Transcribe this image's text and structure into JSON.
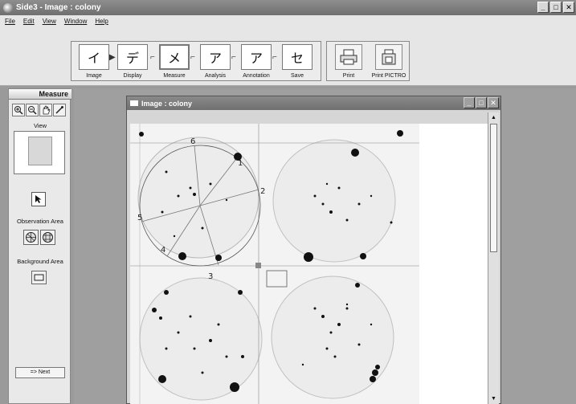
{
  "window": {
    "title": "Side3 - Image : colony"
  },
  "menu": [
    "File",
    "Edit",
    "View",
    "Window",
    "Help"
  ],
  "workflow": [
    {
      "glyph": "イ",
      "label": "Image"
    },
    {
      "glyph": "デ",
      "label": "Display"
    },
    {
      "glyph": "メ",
      "label": "Measure"
    },
    {
      "glyph": "ア",
      "label": "Analysis"
    },
    {
      "glyph": "ア",
      "label": "Annotation"
    },
    {
      "glyph": "セ",
      "label": "Save"
    }
  ],
  "print": {
    "print_label": "Print",
    "print_pictro_label": "Print PICTRO"
  },
  "left_panel": {
    "tab": "Measure",
    "view_label": "View",
    "observation_label": "Observation Area",
    "background_label": "Background Area",
    "next_label": "=> Next"
  },
  "child_window": {
    "title": "Image : colony"
  },
  "sectors": {
    "labels": [
      "1",
      "2",
      "3",
      "4",
      "5",
      "6"
    ]
  }
}
